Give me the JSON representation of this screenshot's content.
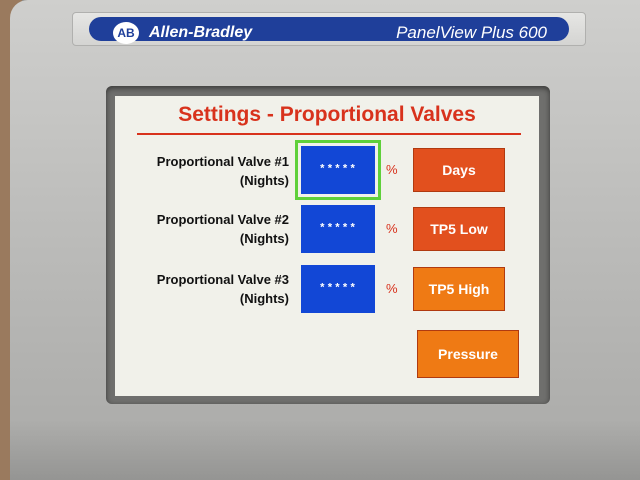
{
  "device": {
    "brand": "Allen-Bradley",
    "logo_text": "AB",
    "model": "PanelView Plus 600"
  },
  "screen": {
    "title": "Settings - Proportional Valves",
    "valves": [
      {
        "label_line1": "Proportional Valve #1",
        "label_line2": "(Nights)",
        "value": "*****",
        "unit": "%"
      },
      {
        "label_line1": "Proportional Valve #2",
        "label_line2": "(Nights)",
        "value": "*****",
        "unit": "%"
      },
      {
        "label_line1": "Proportional Valve #3",
        "label_line2": "(Nights)",
        "value": "*****",
        "unit": "%"
      }
    ],
    "nav_buttons": [
      {
        "label": "Days"
      },
      {
        "label": "TP5 Low"
      },
      {
        "label": "TP5 High"
      },
      {
        "label": "Pressure"
      }
    ]
  },
  "colors": {
    "title_red": "#d8321c",
    "input_blue": "#1247d6",
    "selection_green": "#5fd03a",
    "button_orange": "#ef7a14",
    "button_orange_active": "#e2501e",
    "brand_blue": "#1f3f9a"
  }
}
